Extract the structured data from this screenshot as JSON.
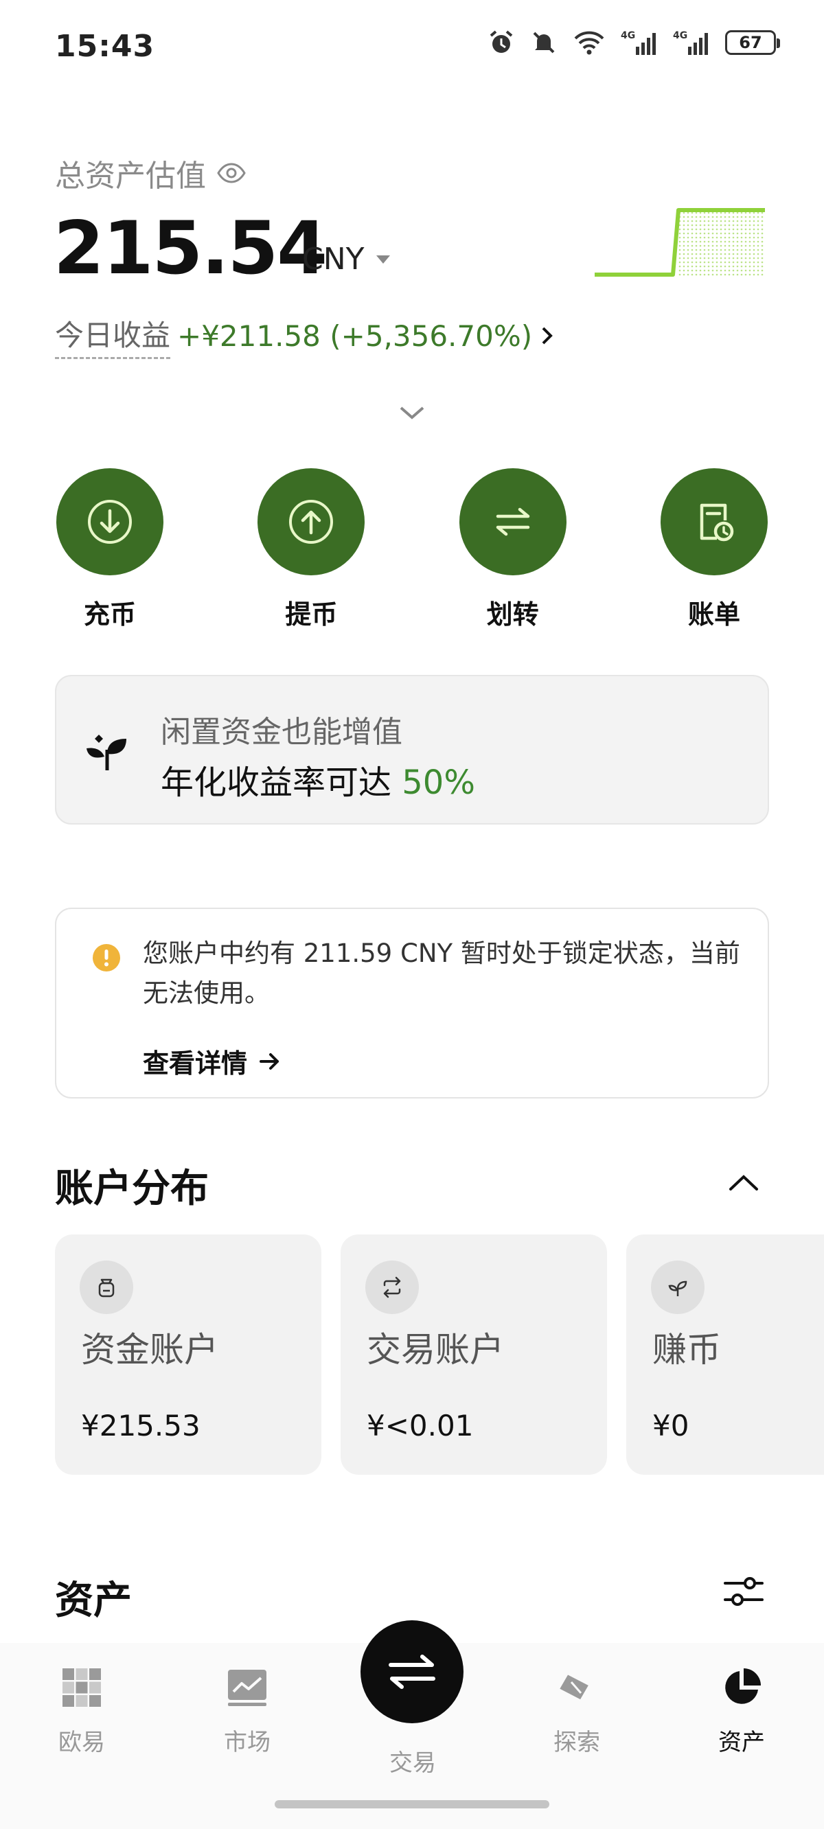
{
  "status_bar": {
    "time": "15:43",
    "battery": "67",
    "icons": [
      "alarm-icon",
      "mute-icon",
      "wifi-icon",
      "signal-4g-icon",
      "signal-4g-icon",
      "battery-icon"
    ]
  },
  "header": {
    "total_label": "总资产估值",
    "total_value": "215.54",
    "currency": "CNY",
    "today_label": "今日收益",
    "today_value": "+¥211.58 (+5,356.70%)"
  },
  "actions": [
    {
      "label": "充币",
      "icon": "deposit-icon"
    },
    {
      "label": "提币",
      "icon": "withdraw-icon"
    },
    {
      "label": "划转",
      "icon": "transfer-icon"
    },
    {
      "label": "账单",
      "icon": "bill-icon"
    }
  ],
  "promo": {
    "line1": "闲置资金也能增值",
    "line2_prefix": "年化收益率可达 ",
    "rate": "50%"
  },
  "locked_notice": {
    "text": "您账户中约有 211.59 CNY 暂时处于锁定状态，当前无法使用。",
    "link": "查看详情"
  },
  "account_distribution": {
    "title": "账户分布",
    "accounts": [
      {
        "name": "资金账户",
        "value": "¥215.53",
        "icon": "wallet-icon"
      },
      {
        "name": "交易账户",
        "value": "¥<0.01",
        "icon": "exchange-icon"
      },
      {
        "name": "赚币",
        "value": "¥0",
        "icon": "sprout-icon"
      }
    ]
  },
  "assets_section": {
    "title": "资产"
  },
  "bottom_nav": {
    "items": [
      {
        "label": "欧易",
        "icon": "okx-logo-icon",
        "active": false
      },
      {
        "label": "市场",
        "icon": "market-chart-icon",
        "active": false
      },
      {
        "label": "交易",
        "icon": "trade-swap-icon",
        "active": false
      },
      {
        "label": "探索",
        "icon": "explore-compass-icon",
        "active": false
      },
      {
        "label": "资产",
        "icon": "assets-pie-icon",
        "active": true
      }
    ]
  },
  "colors": {
    "accent_green": "#3b6d24",
    "profit_green": "#3d7a2a",
    "sparkline": "#8fd13a"
  }
}
